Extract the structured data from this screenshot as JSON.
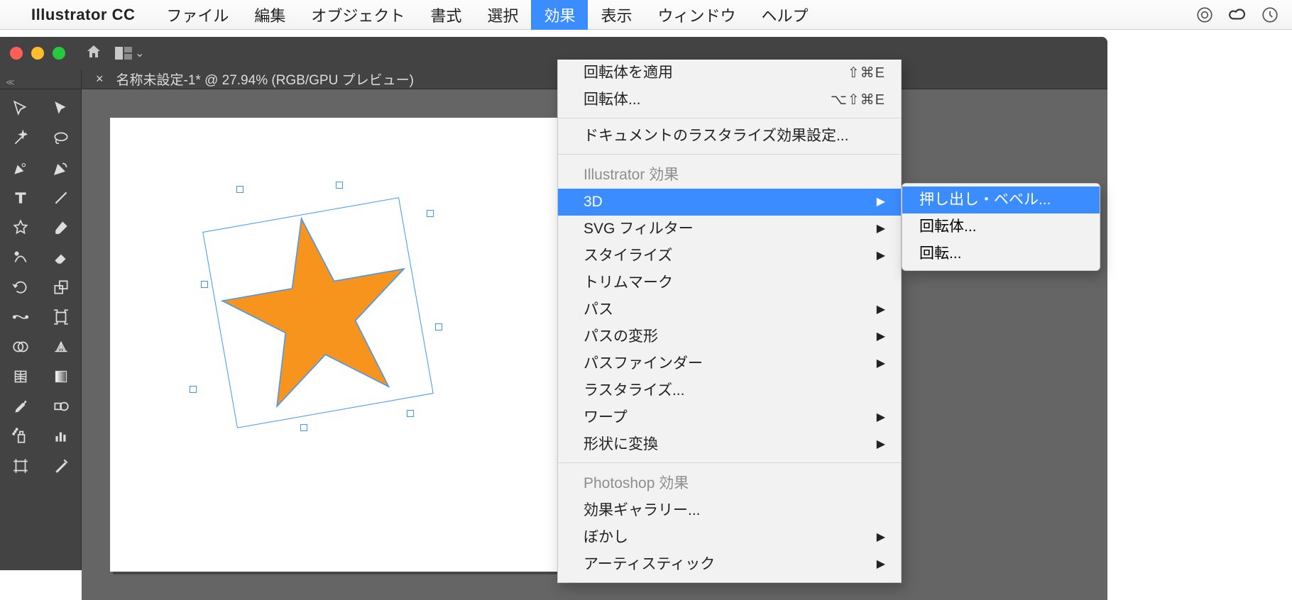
{
  "menubar": {
    "app_name": "Illustrator CC",
    "items": [
      "ファイル",
      "編集",
      "オブジェクト",
      "書式",
      "選択",
      "効果",
      "表示",
      "ウィンドウ",
      "ヘルプ"
    ],
    "open_index": 5
  },
  "document": {
    "tab_label": "名称未設定-1* @ 27.94% (RGB/GPU プレビュー)"
  },
  "star": {
    "fill": "#f7941e",
    "stroke": "#3b97ff"
  },
  "menu": {
    "apply_label": "回転体を適用",
    "apply_shortcut": "⇧⌘E",
    "last_label": "回転体...",
    "last_shortcut": "⌥⇧⌘E",
    "raster_label": "ドキュメントのラスタライズ効果設定...",
    "section_ai": "Illustrator 効果",
    "items_ai": [
      {
        "label": "3D",
        "arrow": true,
        "selected": true
      },
      {
        "label": "SVG フィルター",
        "arrow": true
      },
      {
        "label": "スタイライズ",
        "arrow": true
      },
      {
        "label": "トリムマーク",
        "arrow": false
      },
      {
        "label": "パス",
        "arrow": true
      },
      {
        "label": "パスの変形",
        "arrow": true
      },
      {
        "label": "パスファインダー",
        "arrow": true
      },
      {
        "label": "ラスタライズ...",
        "arrow": false
      },
      {
        "label": "ワープ",
        "arrow": true
      },
      {
        "label": "形状に変換",
        "arrow": true
      }
    ],
    "section_ps": "Photoshop 効果",
    "items_ps": [
      {
        "label": "効果ギャラリー..."
      },
      {
        "label": "ぼかし",
        "arrow": true
      },
      {
        "label": "アーティスティック",
        "arrow": true
      }
    ]
  },
  "submenu": {
    "items": [
      {
        "label": "押し出し・ベベル...",
        "selected": true
      },
      {
        "label": "回転体..."
      },
      {
        "label": "回転..."
      }
    ]
  },
  "icons": {
    "target": "target-icon",
    "cc": "creative-cloud-icon",
    "timemachine": "time-machine-icon"
  }
}
